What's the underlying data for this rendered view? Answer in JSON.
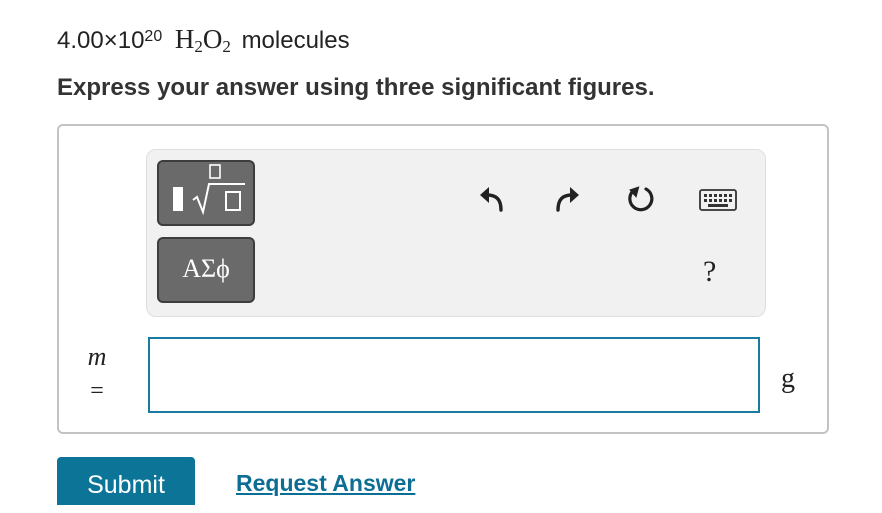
{
  "question": {
    "coefficient": "4.00×10",
    "exponent": "20",
    "formula_h": "H",
    "formula_h_sub": "2",
    "formula_o": "O",
    "formula_o_sub": "2",
    "rest": "molecules"
  },
  "instruction": "Express your answer using three significant figures.",
  "toolbar": {
    "templates_icon": "fraction-sqrt-template-icon",
    "symbols_label": "ΑΣϕ",
    "undo_icon": "undo-icon",
    "redo_icon": "redo-icon",
    "reset_icon": "reset-icon",
    "keyboard_icon": "keyboard-icon",
    "help_label": "?"
  },
  "answer": {
    "variable": "m",
    "equals": "=",
    "value": "",
    "unit": "g"
  },
  "actions": {
    "submit_label": "Submit",
    "request_label": "Request Answer"
  },
  "colors": {
    "accent": "#0c7597",
    "link": "#0d6e95",
    "input_border": "#1a7ba1",
    "toolbar_button": "#6a6a6a"
  }
}
